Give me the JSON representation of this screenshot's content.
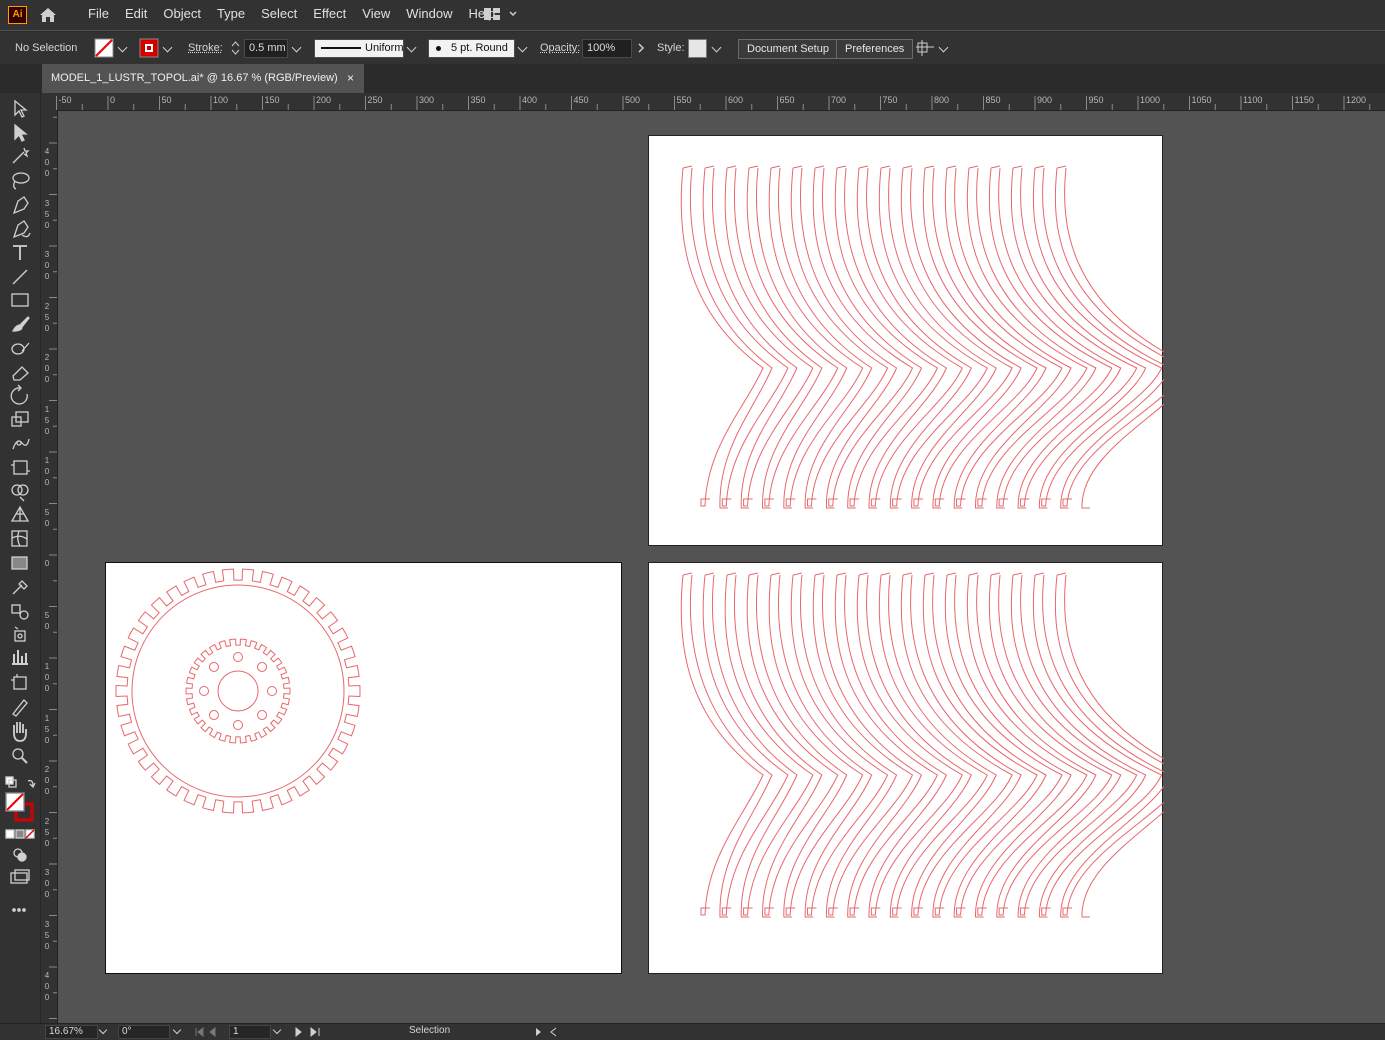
{
  "app": {
    "logo_text": "Ai",
    "accent": "#ff9a00"
  },
  "menu": {
    "items": [
      "File",
      "Edit",
      "Object",
      "Type",
      "Select",
      "Effect",
      "View",
      "Window",
      "Help"
    ]
  },
  "control_bar": {
    "selection_label": "No Selection",
    "stroke_label": "Stroke:",
    "stroke_value": "0.5 mm",
    "profile_label": "Uniform",
    "brush_label": "5 pt. Round",
    "opacity_label": "Opacity:",
    "opacity_value": "100%",
    "style_label": "Style:",
    "document_setup": "Document Setup",
    "preferences": "Preferences"
  },
  "document_tab": {
    "title": "MODEL_1_LUSTR_TOPOL.ai* @ 16.67 % (RGB/Preview)",
    "close": "×"
  },
  "ruler": {
    "h_labels": [
      "-50",
      "0",
      "50",
      "100",
      "150",
      "200",
      "250",
      "300",
      "350",
      "400",
      "450",
      "500",
      "550",
      "600",
      "650",
      "700",
      "750",
      "800",
      "850",
      "900",
      "950",
      "1000",
      "1050",
      "1100",
      "1150",
      "1200"
    ],
    "v_labels": [
      "400",
      "350",
      "300",
      "250",
      "200",
      "150",
      "100",
      "50",
      "0",
      "50",
      "100",
      "150",
      "200",
      "250",
      "300",
      "350",
      "400"
    ]
  },
  "status_bar": {
    "zoom": "16.67%",
    "rotation": "0°",
    "artboard_number": "1",
    "tool_name": "Selection"
  },
  "colors": {
    "stroke": "#e8676b",
    "ui_bg": "#323232",
    "canvas": "#535353"
  },
  "tools": [
    "selection-icon",
    "direct-selection-icon",
    "magic-wand-icon",
    "lasso-icon",
    "pen-icon",
    "curvature-icon",
    "type-icon",
    "line-icon",
    "rectangle-icon",
    "paintbrush-icon",
    "shaper-icon",
    "eraser-icon",
    "rotate-icon",
    "scale-icon",
    "puppet-warp-icon",
    "free-transform-icon",
    "shape-builder-icon",
    "perspective-grid-icon",
    "mesh-icon",
    "gradient-icon",
    "eyedropper-icon",
    "blend-icon",
    "symbol-sprayer-icon",
    "column-graph-icon",
    "artboard-icon",
    "slice-icon",
    "hand-icon",
    "zoom-icon"
  ]
}
